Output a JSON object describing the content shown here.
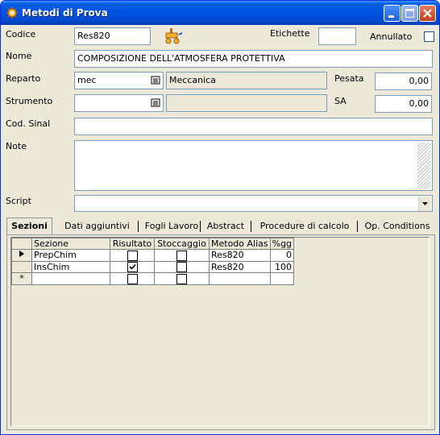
{
  "window": {
    "title": "Metodi di Prova"
  },
  "form": {
    "codice_label": "Codice",
    "codice_value": "Res820",
    "etichette_label": "Etichette",
    "etichette_value": "",
    "annullato_label": "Annullato",
    "annullato_checked": false,
    "nome_label": "Nome",
    "nome_value": "COMPOSIZIONE DELL'ATMOSFERA PROTETTIVA",
    "reparto_label": "Reparto",
    "reparto_code": "mec",
    "reparto_desc": "Meccanica",
    "pesata_label": "Pesata",
    "pesata_value": "0,00",
    "strumento_label": "Strumento",
    "strumento_code": "",
    "strumento_desc": "",
    "sa_label": "SA",
    "sa_value": "0,00",
    "cod_sinal_label": "Cod. Sinal",
    "cod_sinal_value": "",
    "note_label": "Note",
    "note_value": "",
    "script_label": "Script",
    "script_value": ""
  },
  "tabs": [
    "Sezioni",
    "Dati aggiuntivi",
    "Fogli Lavoro",
    "Abstract",
    "Procedure di calcolo",
    "Op. Conditions"
  ],
  "active_tab": "Sezioni",
  "grid": {
    "columns": [
      "Sezione",
      "Risultato",
      "Stoccaggio",
      "Metodo Alias",
      "%gg"
    ],
    "rows": [
      {
        "sezione": "PrepChim",
        "risultato": false,
        "stoccaggio": false,
        "metodo_alias": "Res820",
        "gg": "0"
      },
      {
        "sezione": "InsChim",
        "risultato": true,
        "stoccaggio": false,
        "metodo_alias": "Res820",
        "gg": "100"
      }
    ],
    "new_row_marker": "*"
  }
}
